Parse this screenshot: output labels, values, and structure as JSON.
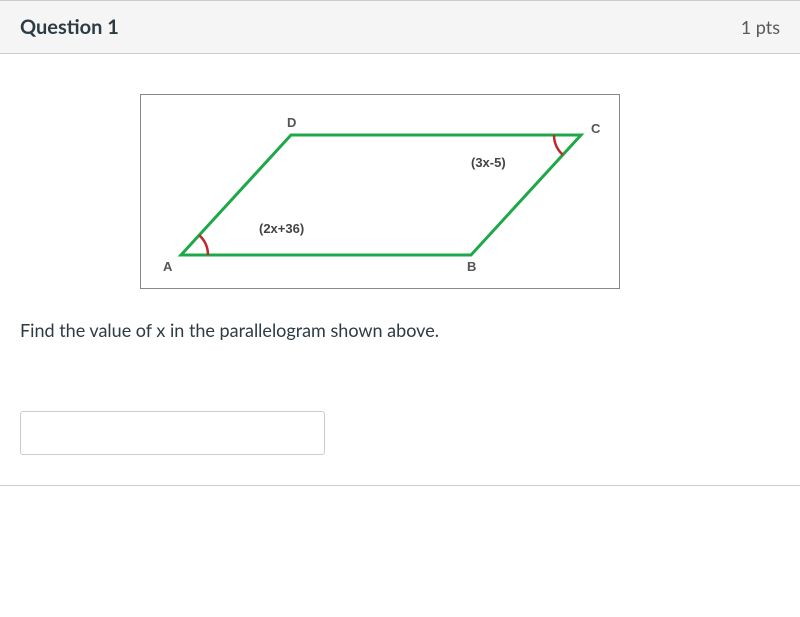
{
  "header": {
    "title": "Question 1",
    "points": "1 pts"
  },
  "figure": {
    "vertices": {
      "A": "A",
      "B": "B",
      "C": "C",
      "D": "D"
    },
    "angles": {
      "A": "(2x+36)",
      "C": "(3x-5)"
    },
    "color_side": "#1fa84a",
    "color_arc": "#c1272d"
  },
  "prompt": "Find the value of x in the parallelogram shown above.",
  "answer": ""
}
